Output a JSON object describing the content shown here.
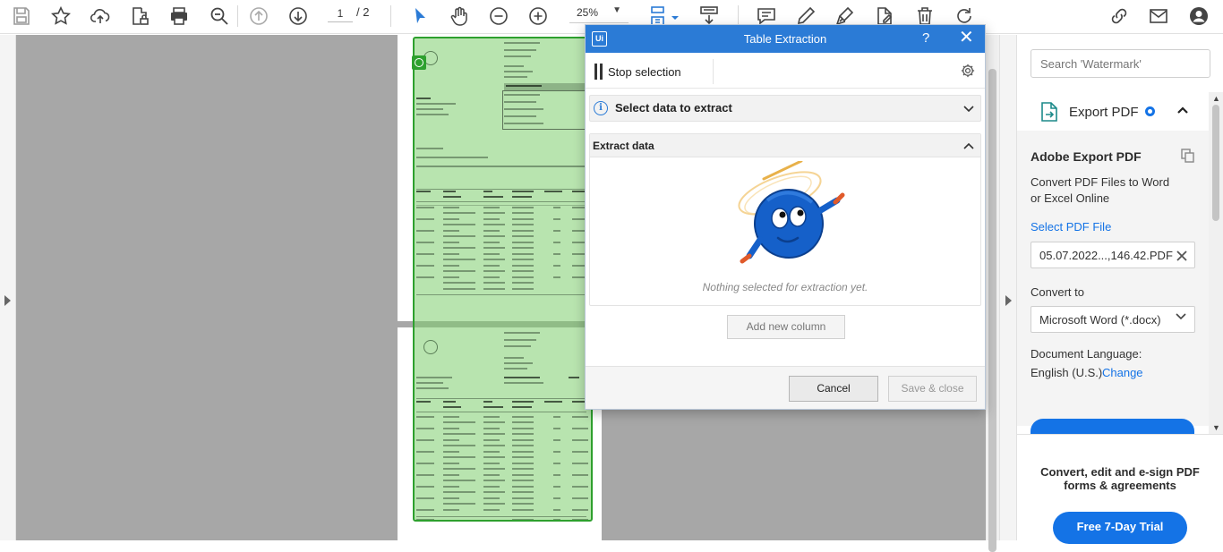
{
  "toolbar": {
    "page_current": "1",
    "page_total": "/ 2",
    "zoom_level": "25%",
    "tools": [
      "save-icon",
      "star-icon",
      "upload-cloud-icon",
      "lock-document-icon",
      "print-icon",
      "zoom-search-icon",
      "page-up-icon",
      "page-down-icon",
      "select-cursor-icon",
      "hand-icon",
      "zoom-out-icon",
      "zoom-in-icon",
      "fit-page-icon",
      "scroll-mode-icon",
      "comment-icon",
      "pen-icon",
      "sign-icon",
      "edit-document-icon",
      "trash-icon",
      "rotate-icon",
      "link-icon",
      "mail-icon",
      "account-icon"
    ]
  },
  "dialog": {
    "title": "Table Extraction",
    "help": "?",
    "close": "✕",
    "stop_selection": "Stop selection",
    "section_select": "Select data to extract",
    "section_extract": "Extract data",
    "empty_message": "Nothing selected for extraction yet.",
    "add_column": "Add new column",
    "cancel": "Cancel",
    "save_close": "Save & close",
    "accent_color": "#2b7bd6"
  },
  "pane": {
    "search_placeholder": "Search 'Watermark'",
    "export_title": "Export PDF",
    "adobe_title": "Adobe Export PDF",
    "description": "Convert PDF Files to Word or Excel Online",
    "select_pdf": "Select PDF File",
    "file_name": "05.07.2022...,146.42.PDF",
    "convert_to_label": "Convert to",
    "convert_to_value": "Microsoft Word (*.docx)",
    "doc_language_label": "Document Language:",
    "doc_language_value": "English (U.S.)",
    "change_link": "Change",
    "promo_text": "Convert, edit and e-sign PDF forms & agreements",
    "trial_button": "Free 7-Day Trial",
    "accent_color": "#1473e6"
  }
}
